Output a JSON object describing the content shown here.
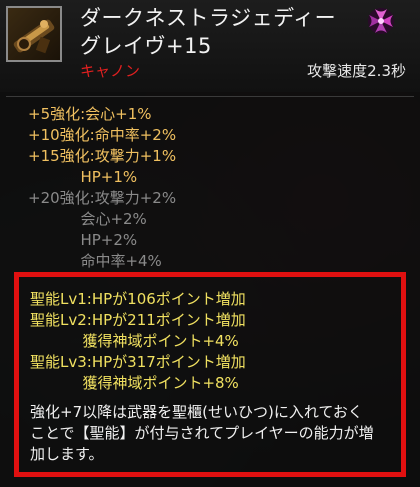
{
  "item": {
    "name": "ダークネストラジェディーグレイヴ+15",
    "type": "キャノン",
    "attack_speed": "攻撃速度2.3秒",
    "icon": "cannon-weapon-icon",
    "class_icon": "purple-swirl-icon"
  },
  "enhancements": [
    {
      "text": "+5強化:会心+1%",
      "active": true
    },
    {
      "text": "+10強化:命中率+2%",
      "active": true
    },
    {
      "text": "+15強化:攻撃力+1%",
      "active": true
    },
    {
      "text": "           HP+1%",
      "active": true
    },
    {
      "text": "+20強化:攻撃力+2%",
      "active": false
    },
    {
      "text": "           会心+2%",
      "active": false
    },
    {
      "text": "           HP+2%",
      "active": false
    },
    {
      "text": "           命中率+4%",
      "active": false
    }
  ],
  "holy_abilities": [
    "聖能Lv1:HPが106ポイント増加",
    "聖能Lv2:HPが211ポイント増加",
    "           獲得神域ポイント+4%",
    "聖能Lv3:HPが317ポイント増加",
    "           獲得神域ポイント+8%"
  ],
  "description": [
    "強化+7以降は武器を聖櫃(せいひつ)に入れておく",
    "ことで【聖能】が付与されてプレイヤーの能力が増",
    "加します。"
  ],
  "colors": {
    "item_type": "#e02020",
    "enh_active": "#f0c060",
    "enh_inactive": "#8a8a8a",
    "holy": "#f0e060",
    "highlight": "#e01010"
  }
}
